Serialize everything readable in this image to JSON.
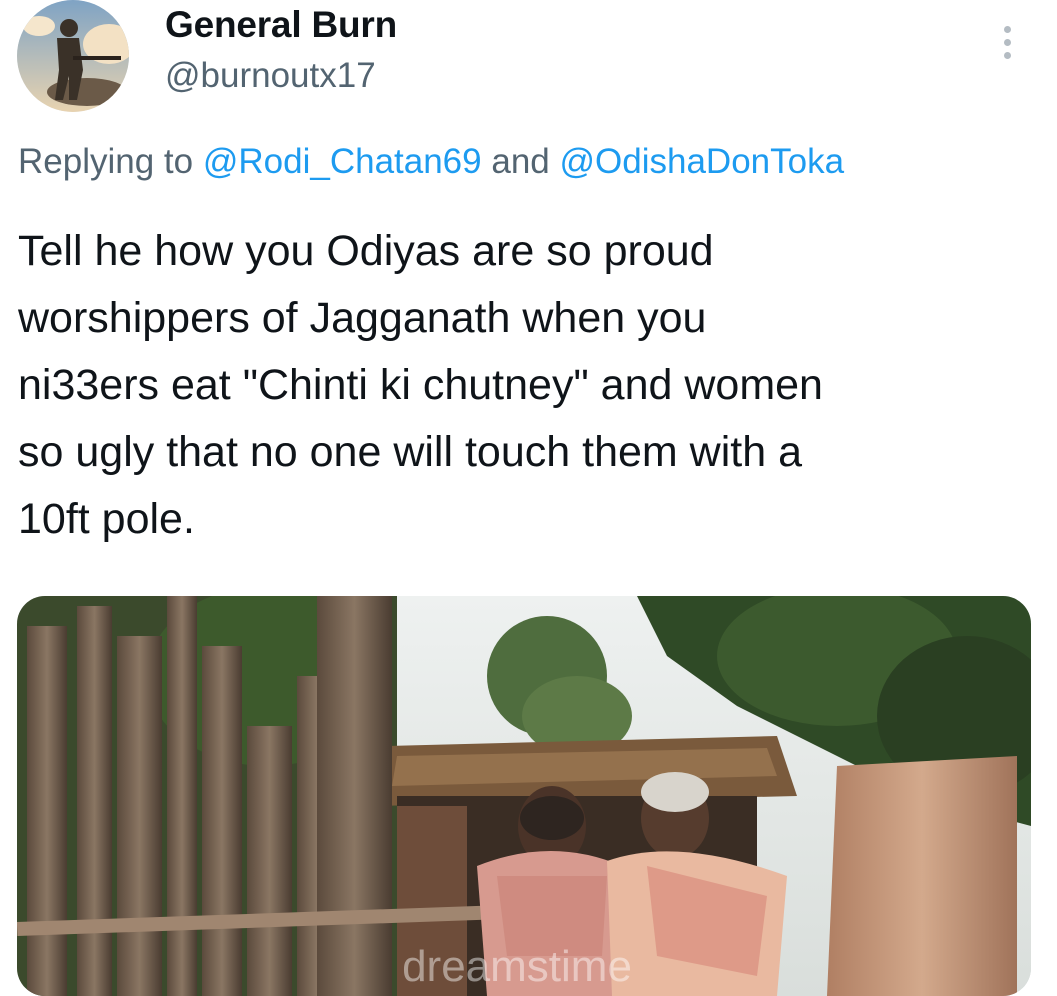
{
  "author": {
    "display_name": "General Burn",
    "handle": "@burnoutx17",
    "avatar_icon": "soldier-silhouette-avatar"
  },
  "reply_context": {
    "prefix": "Replying to",
    "mentions": [
      "@Rodi_Chatan69",
      "@OdishaDonToka"
    ],
    "conjunction": "and"
  },
  "tweet": {
    "lines": [
      "Tell he how you Odiyas are so proud",
      "worshippers of Jagganath when you",
      "ni33ers eat \"Chinti ki chutney\" and women",
      "so ugly that no one will touch them with a",
      "10ft pole."
    ]
  },
  "media": {
    "type": "photo",
    "watermark": "dreamstime"
  },
  "icons": {
    "more": "more-options-icon"
  },
  "colors": {
    "accent": "#1d9bf0",
    "secondary_text": "#536471",
    "primary_text": "#0f1419"
  }
}
